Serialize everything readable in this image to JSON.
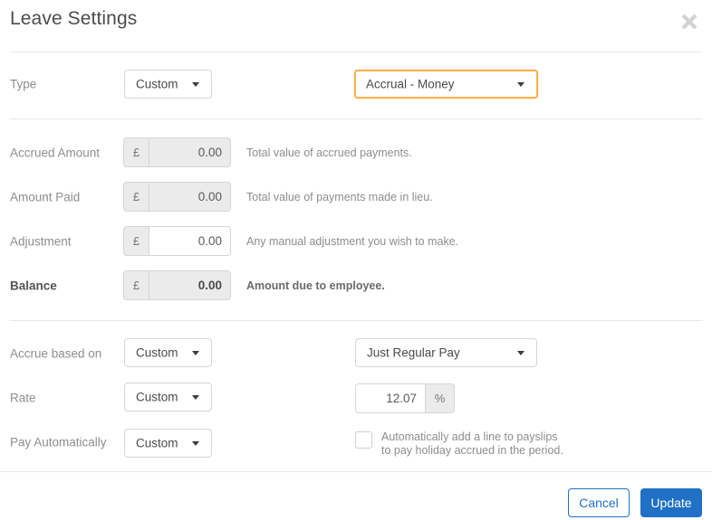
{
  "dialog": {
    "title": "Leave Settings",
    "close_icon": "close-icon"
  },
  "type_row": {
    "label": "Type",
    "mode_select": "Custom",
    "leave_type_select": "Accrual - Money"
  },
  "amounts": {
    "currency_symbol": "£",
    "rows": [
      {
        "label": "Accrued Amount",
        "value": "0.00",
        "hint": "Total value of accrued payments.",
        "editable": false,
        "strong": false
      },
      {
        "label": "Amount Paid",
        "value": "0.00",
        "hint": "Total value of payments made in lieu.",
        "editable": false,
        "strong": false
      },
      {
        "label": "Adjustment",
        "value": "0.00",
        "hint": "Any manual adjustment you wish to make.",
        "editable": true,
        "strong": false
      },
      {
        "label": "Balance",
        "value": "0.00",
        "hint": "Amount due to employee.",
        "editable": false,
        "strong": true
      }
    ]
  },
  "accrual": {
    "accrue_based_on": {
      "label": "Accrue based on",
      "mode_select": "Custom",
      "basis_select": "Just Regular Pay"
    },
    "rate": {
      "label": "Rate",
      "mode_select": "Custom",
      "value": "12.07",
      "unit": "%"
    },
    "pay_automatically": {
      "label": "Pay Automatically",
      "mode_select": "Custom",
      "checkbox_label": "Automatically add a line to payslips\nto pay holiday accrued in the period."
    }
  },
  "footer": {
    "cancel_label": "Cancel",
    "update_label": "Update"
  },
  "colors": {
    "primary": "#2070c5",
    "focus_border": "#f5b14a",
    "label_grey": "#8d8d8d",
    "divider": "#e7e7e7"
  }
}
